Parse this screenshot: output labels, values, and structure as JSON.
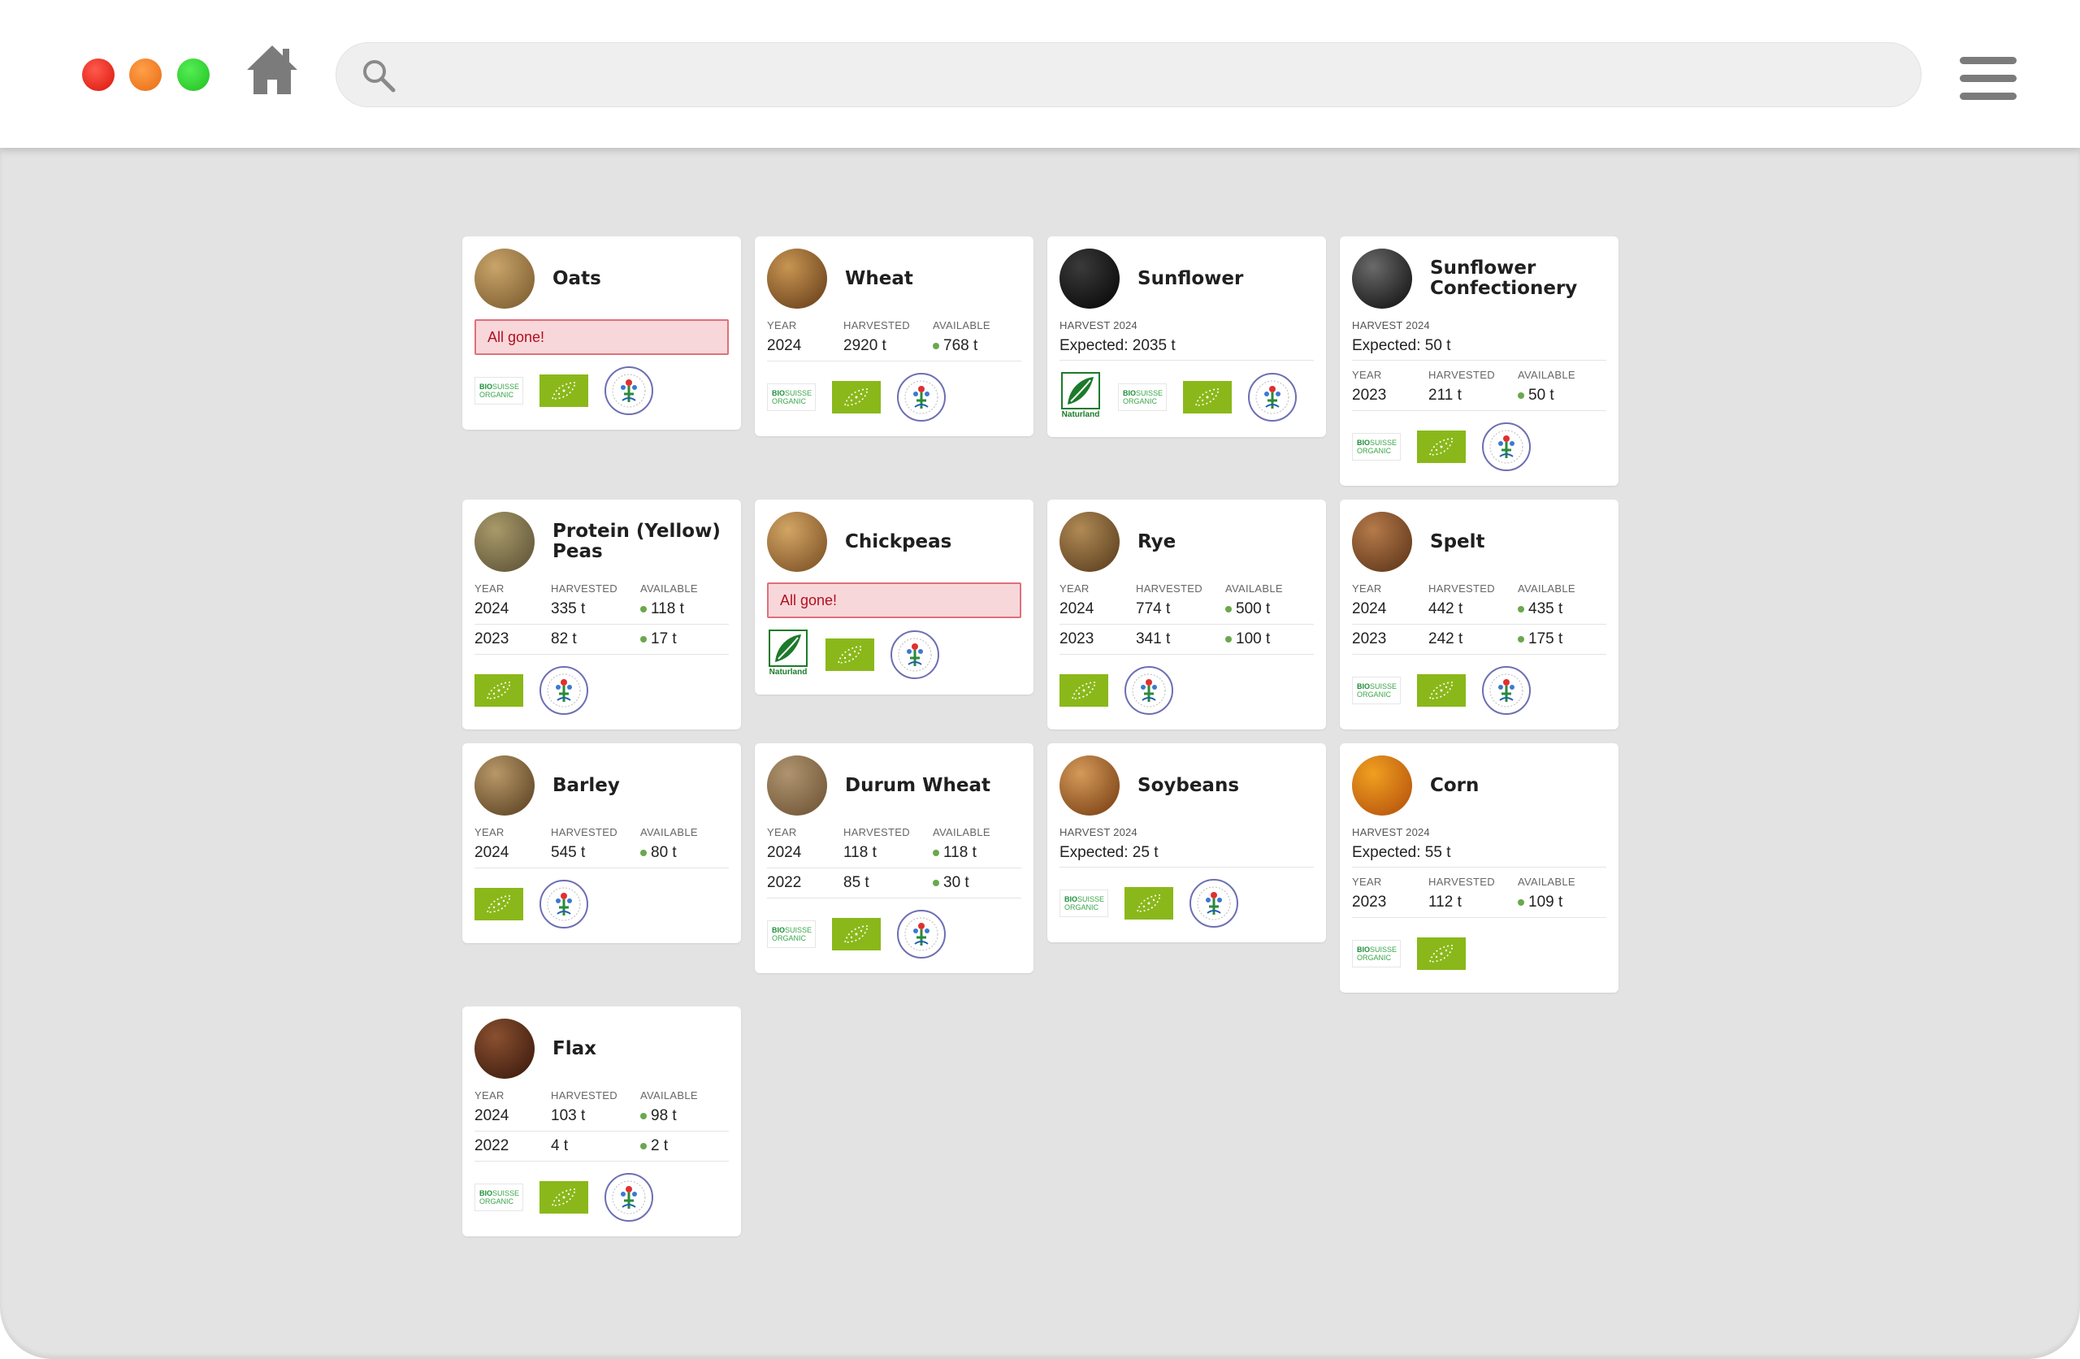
{
  "browser": {
    "search": {
      "placeholder": "",
      "value": ""
    },
    "icons": [
      "close-dot",
      "minimize-dot",
      "maximize-dot",
      "home-icon",
      "search-icon",
      "hamburger-menu-icon"
    ]
  },
  "labels": {
    "year": "YEAR",
    "harvested": "HARVESTED",
    "available": "AVAILABLE",
    "all_gone": "All gone!",
    "naturland": "Naturland",
    "bio": "BIO",
    "suisse": "SUISSE",
    "organic": "ORGANIC"
  },
  "colors": {
    "available_dot": "#6aa84f",
    "eu_organic": "#8ab81a",
    "gone_bg": "#f8d7da",
    "gone_text": "#b01020"
  },
  "products": [
    {
      "name": "Oats",
      "grain": [
        "#c9a46a",
        "#8a6a3a"
      ],
      "status": "gone",
      "logos": [
        "bio-suisse",
        "eu-organic",
        "swiss-seal"
      ]
    },
    {
      "name": "Wheat",
      "grain": [
        "#c79552",
        "#7a4f24"
      ],
      "rows": [
        {
          "year": "2024",
          "harvested": "2920 t",
          "available": "768 t"
        }
      ],
      "logos": [
        "bio-suisse",
        "eu-organic",
        "swiss-seal"
      ]
    },
    {
      "name": "Sunflower",
      "grain": [
        "#3a3a3a",
        "#111111"
      ],
      "harvest_label": "HARVEST 2024",
      "expected": "Expected: 2035 t",
      "logos": [
        "naturland",
        "bio-suisse",
        "eu-organic",
        "swiss-seal"
      ]
    },
    {
      "name": "Sunflower Confectionery",
      "grain": [
        "#6a6a6a",
        "#222222"
      ],
      "harvest_label": "HARVEST 2024",
      "expected": "Expected: 50 t",
      "rows": [
        {
          "year": "2023",
          "harvested": "211 t",
          "available": "50 t"
        }
      ],
      "logos": [
        "bio-suisse",
        "eu-organic",
        "swiss-seal"
      ]
    },
    {
      "name": "Protein (Yellow) Peas",
      "grain": [
        "#a99a6a",
        "#6b6040"
      ],
      "rows": [
        {
          "year": "2024",
          "harvested": "335 t",
          "available": "118 t"
        },
        {
          "year": "2023",
          "harvested": "82 t",
          "available": "17 t"
        }
      ],
      "logos": [
        "eu-organic",
        "swiss-seal"
      ]
    },
    {
      "name": "Chickpeas",
      "grain": [
        "#d2a565",
        "#8c6030"
      ],
      "status": "gone",
      "logos": [
        "naturland",
        "eu-organic",
        "swiss-seal"
      ]
    },
    {
      "name": "Rye",
      "grain": [
        "#b08a55",
        "#6a4c28"
      ],
      "rows": [
        {
          "year": "2024",
          "harvested": "774 t",
          "available": "500 t"
        },
        {
          "year": "2023",
          "harvested": "341 t",
          "available": "100 t"
        }
      ],
      "logos": [
        "eu-organic",
        "swiss-seal"
      ]
    },
    {
      "name": "Spelt",
      "grain": [
        "#b57a4a",
        "#6e4222"
      ],
      "rows": [
        {
          "year": "2024",
          "harvested": "442 t",
          "available": "435 t"
        },
        {
          "year": "2023",
          "harvested": "242 t",
          "available": "175 t"
        }
      ],
      "logos": [
        "bio-suisse",
        "eu-organic",
        "swiss-seal"
      ]
    },
    {
      "name": "Barley",
      "grain": [
        "#b89868",
        "#6c5230"
      ],
      "rows": [
        {
          "year": "2024",
          "harvested": "545 t",
          "available": "80 t"
        }
      ],
      "logos": [
        "eu-organic",
        "swiss-seal"
      ]
    },
    {
      "name": "Durum Wheat",
      "grain": [
        "#b09470",
        "#7a6040"
      ],
      "rows": [
        {
          "year": "2024",
          "harvested": "118 t",
          "available": "118 t"
        },
        {
          "year": "2022",
          "harvested": "85 t",
          "available": "30 t"
        }
      ],
      "logos": [
        "bio-suisse",
        "eu-organic",
        "swiss-seal"
      ]
    },
    {
      "name": "Soybeans",
      "grain": [
        "#d49a5a",
        "#8a5020"
      ],
      "harvest_label": "HARVEST 2024",
      "expected": "Expected: 25 t",
      "logos": [
        "bio-suisse",
        "eu-organic",
        "swiss-seal"
      ]
    },
    {
      "name": "Corn",
      "grain": [
        "#f0a020",
        "#c06010"
      ],
      "harvest_label": "HARVEST 2024",
      "expected": "Expected: 55 t",
      "rows": [
        {
          "year": "2023",
          "harvested": "112 t",
          "available": "109 t"
        }
      ],
      "logos": [
        "bio-suisse",
        "eu-organic"
      ]
    },
    {
      "name": "Flax",
      "grain": [
        "#8a5030",
        "#4a2414"
      ],
      "rows": [
        {
          "year": "2024",
          "harvested": "103 t",
          "available": "98 t"
        },
        {
          "year": "2022",
          "harvested": "4 t",
          "available": "2 t"
        }
      ],
      "logos": [
        "bio-suisse",
        "eu-organic",
        "swiss-seal"
      ]
    }
  ]
}
